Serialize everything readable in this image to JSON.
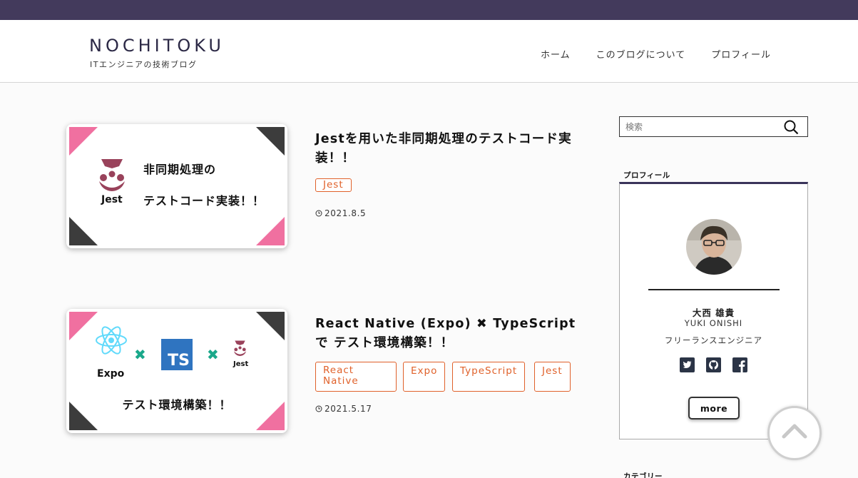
{
  "site": {
    "logo": "NOCHITOKU",
    "tagline": "ITエンジニアの技術ブログ"
  },
  "nav": [
    "ホーム",
    "このブログについて",
    "プロフィール"
  ],
  "posts": [
    {
      "title": "Jestを用いた非同期処理のテストコード実装！！",
      "tags": [
        "Jest"
      ],
      "date": "2021.8.5",
      "thumb": {
        "logo_label": "Jest",
        "line1": "非同期処理の",
        "line2": "テストコード実装！！"
      }
    },
    {
      "title": "React Native (Expo) ✖︎ TypeScriptで テスト環境構築！！",
      "tags": [
        "React Native",
        "Expo",
        "TypeScript",
        "Jest"
      ],
      "date": "2021.5.17",
      "thumb": {
        "expo_label": "Expo",
        "ts_label": "TS",
        "cross": "✖",
        "jest_label": "Jest",
        "caption": "テスト環境構築！！"
      }
    }
  ],
  "search": {
    "placeholder": "検索"
  },
  "profile": {
    "widget_title": "プロフィール",
    "name_jp": "大西 雄貴",
    "name_en": "YUKI ONISHI",
    "role": "フリーランスエンジニア",
    "more_label": "more",
    "social": [
      "twitter-icon",
      "github-icon",
      "facebook-icon"
    ]
  },
  "category_title": "カテゴリー",
  "colors": {
    "topbar": "#433a5c",
    "accent_tag": "#e0612a",
    "pink": "#f070a0",
    "dark": "#3c3c3c",
    "jest": "#99425b",
    "ts": "#2f74c0",
    "react": "#61dafb",
    "cross": "#1aa88a"
  }
}
